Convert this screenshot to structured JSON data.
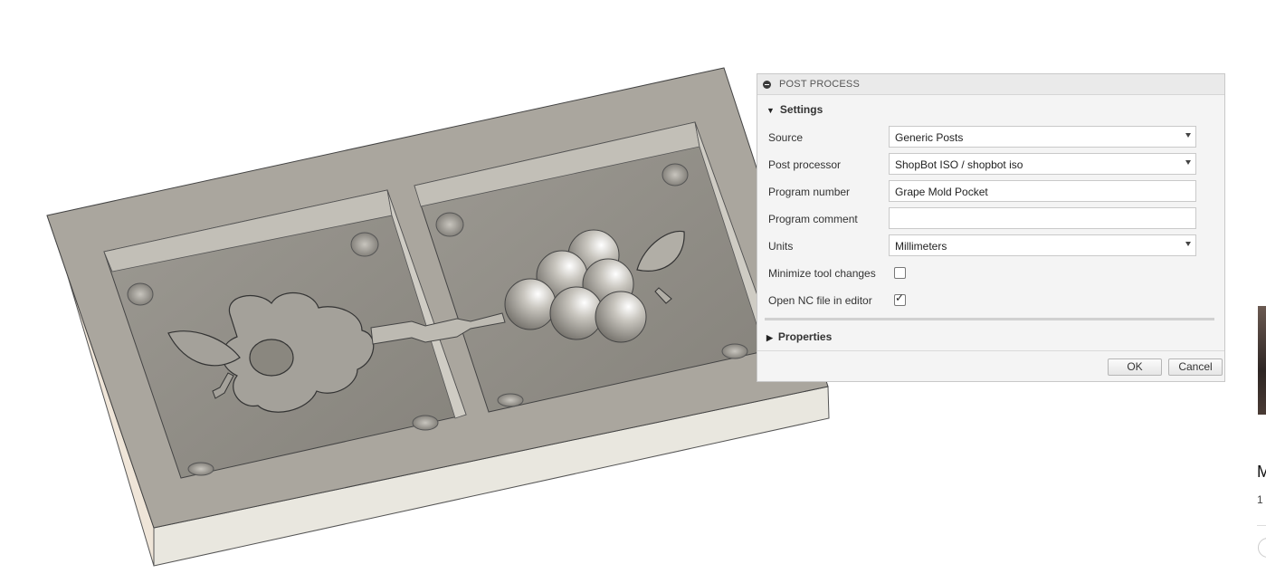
{
  "dialog": {
    "title": "POST PROCESS",
    "settings_section": "Settings",
    "properties_section": "Properties",
    "fields": {
      "source": {
        "label": "Source",
        "value": "Generic Posts"
      },
      "post_processor": {
        "label": "Post processor",
        "value": "ShopBot ISO / shopbot iso"
      },
      "program_number": {
        "label": "Program number",
        "value": "Grape Mold Pocket"
      },
      "program_comment": {
        "label": "Program comment",
        "value": ""
      },
      "units": {
        "label": "Units",
        "value": "Millimeters"
      },
      "minimize_tool_changes": {
        "label": "Minimize tool changes",
        "checked": false
      },
      "open_nc_file": {
        "label": "Open NC file in editor",
        "checked": true
      }
    },
    "buttons": {
      "ok": "OK",
      "cancel": "Cancel"
    }
  },
  "side_panel": {
    "letter": "M",
    "small_text": "1"
  },
  "colors": {
    "dialog_bg": "#f4f4f4",
    "model_top": "#a9a59d",
    "model_side": "#e7e4dc",
    "pocket_floor": "#8f8c84"
  }
}
